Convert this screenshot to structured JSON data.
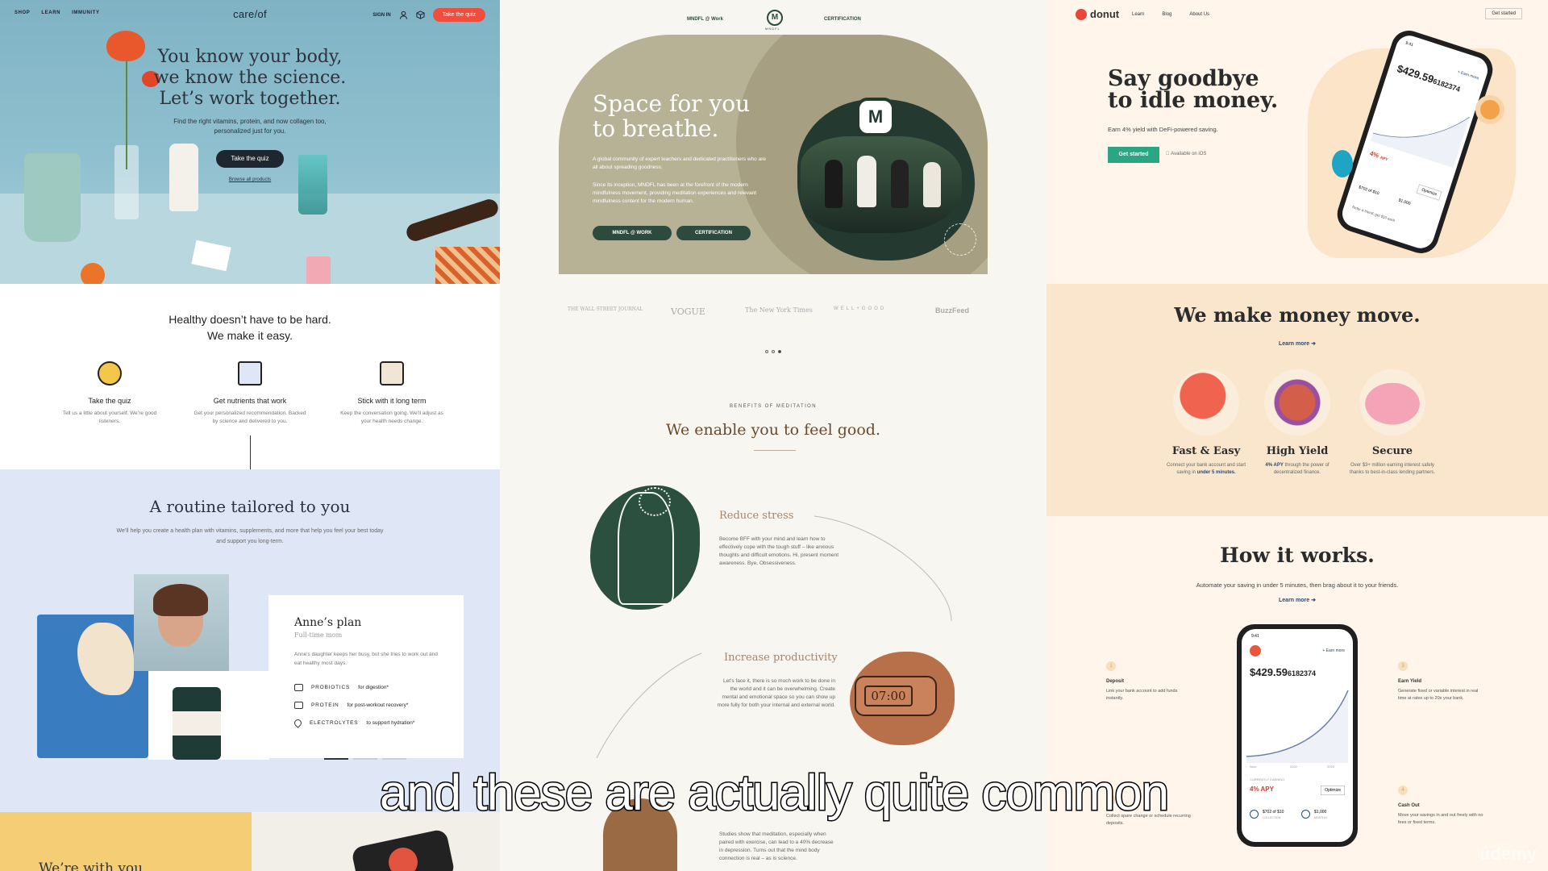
{
  "careof": {
    "nav": {
      "shop": "SHOP",
      "learn": "LEARN",
      "immunity": "IMMUNITY",
      "logo": "care/of",
      "signin": "SIGN IN",
      "quiz": "Take the quiz"
    },
    "hero": {
      "line1": "You know your body,",
      "line2": "we know the science.",
      "line3": "Let’s work together.",
      "sub": "Find the right vitamins, protein, and now collagen too, personalized just for you.",
      "cta": "Take the quiz",
      "browse": "Browse all products"
    },
    "easy": {
      "line1": "Healthy doesn’t have to be hard.",
      "line2": "We make it easy."
    },
    "features": [
      {
        "title": "Take the quiz",
        "desc": "Tell us a little about yourself. We’re good listeners."
      },
      {
        "title": "Get nutrients that work",
        "desc": "Get your personalized recommendation. Backed by science and delivered to you."
      },
      {
        "title": "Stick with it long term",
        "desc": "Keep the conversation going. We’ll adjust as your health needs change."
      }
    ],
    "routine": {
      "title": "A routine tailored to you",
      "desc": "We’ll help you create a health plan with vitamins, supplements, and more that help you feel your best today and support you long-term."
    },
    "plan": {
      "name": "Anne’s plan",
      "role": "Full-time mom",
      "desc": "Anne’s daughter keeps her busy, but she tries to work out and eat healthy most days.",
      "items": [
        {
          "name": "PROBIOTICS",
          "note": "for digestion*"
        },
        {
          "name": "PROTEIN",
          "note": "for post-workout recovery*"
        },
        {
          "name": "ELECTROLYTES",
          "note": "to support hydration*"
        }
      ]
    },
    "bottom": "We’re with you"
  },
  "mndfl": {
    "nav": {
      "work": "MNDFL @ Work",
      "cert": "CERTIFICATION",
      "logo": "M",
      "logo_text": "MNDFL"
    },
    "hero": {
      "line1": "Space for you",
      "line2": "to breathe.",
      "d1": "A global community of expert teachers and dedicated practitioners who are all about spreading goodness.",
      "d2": "Since its inception, MNDFL has been at the forefront of the modern mindfulness movement, providing meditation experiences and relevant mindfulness content for the modern human.",
      "btn1": "MNDFL @ WORK",
      "btn2": "CERTIFICATION"
    },
    "press": [
      "THE WALL STREET JOURNAL",
      "VOGUE",
      "The New York Times",
      "WELL+GOOD",
      "BuzzFeed"
    ],
    "benefits": {
      "kicker": "BENEFITS OF MEDITATION",
      "title": "We enable you to feel good."
    },
    "b1": {
      "title": "Reduce stress",
      "desc": "Become BFF with your mind and learn how to effectively cope with the tough stuff – like anxious thoughts and difficult emotions. Hi, present moment awareness. Bye, Obsessiveness."
    },
    "b2": {
      "title": "Increase productivity",
      "desc": "Let’s face it, there is so much work to be done in the world and it can be overwhelming. Create mental and emotional space so you can show up more fully for both your internal and external world.",
      "clock": "07:00"
    },
    "b3": {
      "desc": "Studies show that meditation, especially when paired with exercise, can lead to a 40% decrease in depression. Turns out that the mind body connection is real – as is science."
    }
  },
  "donut": {
    "nav": {
      "logo": "donut",
      "learn": "Learn",
      "blog": "Blog",
      "about": "About Us",
      "start": "Get started"
    },
    "hero": {
      "line1": "Say goodbye",
      "line2": "to idle money.",
      "sub": "Earn 4% yield with DeFi-powered saving.",
      "btn": "Get started",
      "ios": "Available on iOS"
    },
    "phone": {
      "time": "9:41",
      "earn": "+ Earn more",
      "balance": "$429.59",
      "balance_small": "6182374",
      "apy": "4%",
      "apy_label": "APY",
      "optimize": "Optimize",
      "goal": "$702 of $10",
      "goal2": "$1,000",
      "refer": "Refer a friend, get $10 each"
    },
    "move": {
      "title": "We make money move.",
      "learn": "Learn more"
    },
    "tiles": [
      {
        "title": "Fast & Easy",
        "desc": "Connect your bank account and start saving in",
        "strong": "under 5 minutes."
      },
      {
        "title": "High Yield",
        "desc": "through the power of decentralized finance.",
        "strong": "4% APY"
      },
      {
        "title": "Secure",
        "desc": "Over $3+ million earning interest safely thanks to best-in-class lending partners."
      }
    ],
    "how": {
      "title": "How it works.",
      "desc": "Automate your saving in under 5 minutes, then brag about it to your friends.",
      "learn": "Learn more"
    },
    "steps": [
      {
        "n": "1",
        "title": "Deposit",
        "desc": "Link your bank account to add funds instantly."
      },
      {
        "n": "3",
        "title": "Earn Yield",
        "desc": "Generate fixed or variable interest in real time at rates up to 20x your bank."
      },
      {
        "n": "2",
        "title": "",
        "desc": "Collect spare change or schedule recurring deposits."
      },
      {
        "n": "4",
        "title": "Cash Out",
        "desc": "Move your savings in and out freely with no fees or fixed terms."
      }
    ],
    "phone2": {
      "time": "9:41",
      "earn": "+ Earn more",
      "balance": "$429.59",
      "balance_small": "6182374",
      "apy": "4% APY",
      "currently": "CURRENTLY EARNING",
      "optimize": "Optimize",
      "goal": "$702 of $10",
      "goal2": "$1,000",
      "goal_l": "COLLECTION",
      "goal2_l": "MONTHLY",
      "x1": "Now",
      "x2": "2022",
      "x3": "2025",
      "y1": "$7,000",
      "y2": "$3,000",
      "y3": "$1,000"
    }
  },
  "caption": "and these are actually quite common",
  "watermark": "ûdemy",
  "colors": {
    "careof_red": "#f04d3d",
    "mndfl_green": "#2d4a3e",
    "donut_green": "#2aa683",
    "donut_bg": "#fff5ea"
  }
}
